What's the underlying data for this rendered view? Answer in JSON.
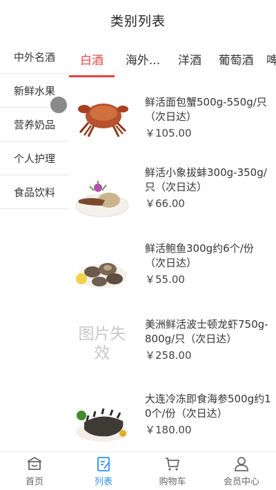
{
  "header": {
    "title": "类别列表"
  },
  "sidebar": {
    "items": [
      {
        "label": "中外名酒"
      },
      {
        "label": "新鲜水果"
      },
      {
        "label": "营养奶品"
      },
      {
        "label": "个人护理"
      },
      {
        "label": "食品饮料"
      }
    ]
  },
  "tabs": [
    {
      "label": "白酒"
    },
    {
      "label": "海外..."
    },
    {
      "label": "洋酒"
    },
    {
      "label": "葡萄酒"
    },
    {
      "label": "啤酒"
    }
  ],
  "products": [
    {
      "name": "鲜活面包蟹500g-550g/只（次日达）",
      "price": "￥105.00",
      "image": "crab"
    },
    {
      "name": "鲜活小象拔蚌300g-350g/只（次日达）",
      "price": "￥66.00",
      "image": "geoduck"
    },
    {
      "name": "鲜活鲍鱼300g约6个/份（次日达）",
      "price": "￥55.00",
      "image": "abalone"
    },
    {
      "name": "美洲鲜活波士顿龙虾750g-800g/只（次日达）",
      "price": "￥258.00",
      "image_broken_text": "图片失效"
    },
    {
      "name": "大连冷冻即食海参500g约10个/份（次日达）",
      "price": "￥180.00",
      "image": "sea-cucumber"
    }
  ],
  "tabbar": [
    {
      "label": "首页",
      "icon": "home-icon"
    },
    {
      "label": "列表",
      "icon": "list-icon"
    },
    {
      "label": "购物车",
      "icon": "cart-icon"
    },
    {
      "label": "会员中心",
      "icon": "user-icon"
    }
  ],
  "colors": {
    "accent_red": "#e64340",
    "tab_active_blue": "#2c8ff0"
  }
}
